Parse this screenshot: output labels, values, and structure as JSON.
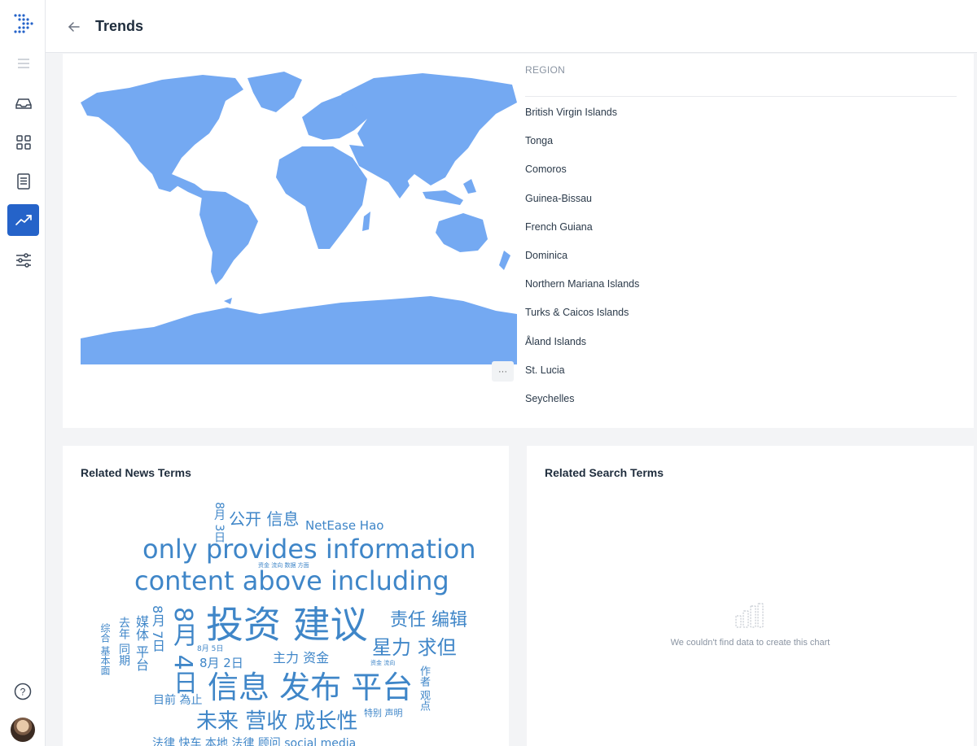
{
  "header": {
    "title": "Trends"
  },
  "sidebar": {
    "items": [
      {
        "icon": "menu-icon"
      },
      {
        "icon": "inbox-icon"
      },
      {
        "icon": "grid-icon"
      },
      {
        "icon": "document-icon"
      },
      {
        "icon": "trending-icon",
        "active": true
      },
      {
        "icon": "sliders-icon"
      }
    ]
  },
  "map": {
    "more_label": "···",
    "fill_color": "#74a9f2",
    "region_header": "REGION",
    "regions": [
      "British Virgin Islands",
      "Tonga",
      "Comoros",
      "Guinea-Bissau",
      "French Guiana",
      "Dominica",
      "Northern Mariana Islands",
      "Turks & Caicos Islands",
      "Åland Islands",
      "St. Lucia",
      "Seychelles"
    ]
  },
  "news": {
    "title": "Related News Terms",
    "words": [
      "8月 3日",
      "公开 信息",
      "NetEase Hao",
      "only provides information",
      "资金 流向 数据 方面",
      "content above including",
      "综合 基本面",
      "去年 同期",
      "媒体 平台",
      "8月 7日",
      "8月 4日",
      "投资 建议",
      "责任 编辑",
      "星力 求但",
      "8月 5日",
      "8月 2日",
      "主力 资金",
      "资金 流向",
      "信息 发布 平台",
      "作者 观点",
      "目前 為止",
      "特别 声明",
      "未来 营收 成长性",
      "法律 快车 本地 法律 顾问 social media"
    ]
  },
  "search": {
    "title": "Related Search Terms",
    "empty_message": "We couldn't find data to create this chart"
  }
}
